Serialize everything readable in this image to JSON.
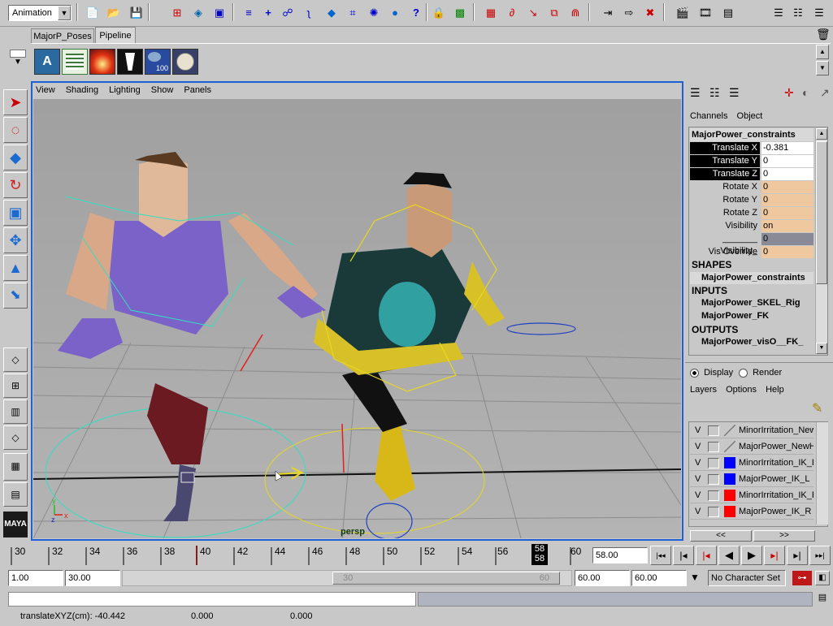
{
  "toolbar": {
    "mode": "Animation"
  },
  "shelf": {
    "tabs": [
      "MajorP_Poses",
      "Pipeline"
    ],
    "active_tab": "Pipeline"
  },
  "viewport": {
    "menu": [
      "View",
      "Shading",
      "Lighting",
      "Show",
      "Panels"
    ],
    "camera_label": "persp"
  },
  "channel_box": {
    "menu": [
      "Channels",
      "Object"
    ],
    "object_name": "MajorPower_constraints",
    "attributes": [
      {
        "label": "Translate X",
        "value": "-0.381",
        "style": "selected"
      },
      {
        "label": "Translate Y",
        "value": "0",
        "style": "selected"
      },
      {
        "label": "Translate Z",
        "value": "0",
        "style": "selected"
      },
      {
        "label": "Rotate X",
        "value": "0",
        "style": "keyed"
      },
      {
        "label": "Rotate Y",
        "value": "0",
        "style": "keyed"
      },
      {
        "label": "Rotate Z",
        "value": "0",
        "style": "keyed"
      },
      {
        "label": "Visibility",
        "value": "on",
        "style": "keyed"
      },
      {
        "label": "_______ Visibility_",
        "value": "0",
        "style": "locked"
      },
      {
        "label": "Vis Override",
        "value": "0",
        "style": "keyed"
      }
    ],
    "shapes_header": "SHAPES",
    "shapes": [
      "MajorPower_constraints"
    ],
    "inputs_header": "INPUTS",
    "inputs": [
      "MajorPower_SKEL_Rig",
      "MajorPower_FK"
    ],
    "outputs_header": "OUTPUTS",
    "outputs": [
      "MajorPower_visO__FK_"
    ]
  },
  "layer_editor": {
    "display_label": "Display",
    "render_label": "Render",
    "menu": [
      "Layers",
      "Options",
      "Help"
    ],
    "layers": [
      {
        "v": "V",
        "name": "MinorIrritation_New",
        "color": "#c8c8c8"
      },
      {
        "v": "V",
        "name": "MajorPower_NewH",
        "color": "#c8c8c8"
      },
      {
        "v": "V",
        "name": "MinorIrritation_IK_L",
        "color": "#0000ff"
      },
      {
        "v": "V",
        "name": "MajorPower_IK_L",
        "color": "#0000ff"
      },
      {
        "v": "V",
        "name": "MinorIrritation_IK_R",
        "color": "#ff0000"
      },
      {
        "v": "V",
        "name": "MajorPower_IK_R",
        "color": "#ff0000"
      }
    ],
    "scroll_left": "<<",
    "scroll_right": ">>"
  },
  "timeline": {
    "ticks": [
      "30",
      "32",
      "34",
      "36",
      "38",
      "40",
      "42",
      "44",
      "46",
      "48",
      "50",
      "52",
      "54",
      "56",
      "58",
      "60"
    ],
    "current_frame_top": "58",
    "current_frame_bottom": "58",
    "current_time": "58.00"
  },
  "range": {
    "start": "1.00",
    "playback_start": "30.00",
    "slider_left": "30",
    "slider_right": "60",
    "playback_end": "60.00",
    "end": "60.00",
    "character_set": "No Character Set"
  },
  "status": {
    "help_text": "translateXYZ(cm): -40.442",
    "val2": "0.000",
    "val3": "0.000"
  },
  "colors": {
    "viewport_bg": "#a8a8a8",
    "viewport_border": "#1f5fd6",
    "selected_attr": "#000000",
    "keyed_attr": "#f0c8a0",
    "locked_attr": "#8a8a96",
    "timeline_current": "#000000"
  }
}
